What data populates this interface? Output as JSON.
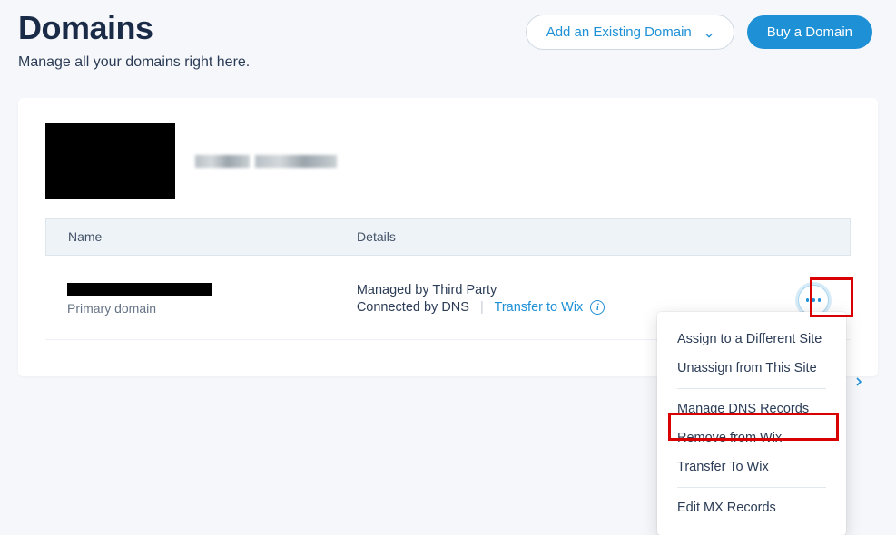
{
  "header": {
    "title": "Domains",
    "subtitle": "Manage all your domains right here.",
    "add_existing_label": "Add an Existing Domain",
    "buy_label": "Buy a Domain"
  },
  "table": {
    "name_header": "Name",
    "details_header": "Details"
  },
  "row": {
    "primary_label": "Primary domain",
    "managed_text": "Managed by Third Party",
    "connected_text": "Connected by DNS",
    "transfer_link": "Transfer to Wix"
  },
  "menu": {
    "assign": "Assign to a Different Site",
    "unassign": "Unassign from This Site",
    "manage_dns": "Manage DNS Records",
    "remove": "Remove from Wix",
    "transfer": "Transfer To Wix",
    "edit_mx": "Edit MX Records"
  }
}
